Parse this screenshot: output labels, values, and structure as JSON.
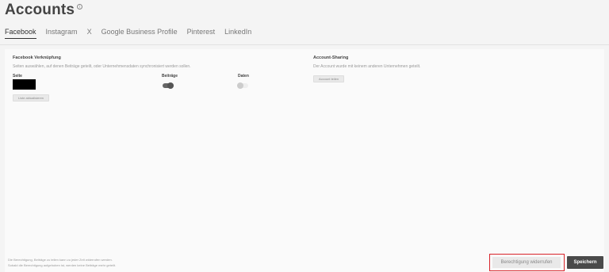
{
  "header": {
    "title": "Accounts",
    "info_icon": "info-icon"
  },
  "tabs": [
    {
      "label": "Facebook",
      "active": true
    },
    {
      "label": "Instagram",
      "active": false
    },
    {
      "label": "X",
      "active": false
    },
    {
      "label": "Google Business Profile",
      "active": false
    },
    {
      "label": "Pinterest",
      "active": false
    },
    {
      "label": "LinkedIn",
      "active": false
    }
  ],
  "facebook_link": {
    "title": "Facebook Verknüpfung",
    "description": "Seiten auswählen, auf denen Beiträge geteilt, oder Unternehmensdaten synchronisiert werden sollen.",
    "col_page": "Seite",
    "col_posts": "Beiträge",
    "col_data": "Daten",
    "posts_toggle_on": true,
    "data_toggle_on": false,
    "refresh_button": "Liste aktualisieren"
  },
  "account_sharing": {
    "title": "Account-Sharing",
    "description": "Der Account wurde mit keinem anderen Unternehmen geteilt.",
    "share_button": "Account teilen"
  },
  "footer": {
    "note_line1": "Die Berechtigung, Beiträge zu teilen kann zu jeder Zeit widerrufen werden.",
    "note_line2": "Sobald die Berechtigung aufgehoben ist, werden keine Beiträge mehr geteilt.",
    "revoke_button": "Berechtigung widerrufen",
    "save_button": "Speichern"
  },
  "colors": {
    "highlight": "#d8232a",
    "primary_button": "#4a4a4a"
  }
}
